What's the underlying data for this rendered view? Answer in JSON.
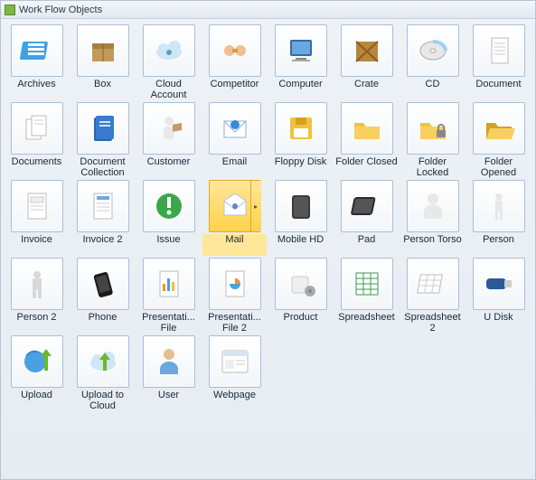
{
  "title": "Work Flow Objects",
  "selected": "mail",
  "items": [
    {
      "id": "archives",
      "label": "Archives"
    },
    {
      "id": "box",
      "label": "Box"
    },
    {
      "id": "cloud-account",
      "label": "Cloud Account"
    },
    {
      "id": "competitor",
      "label": "Competitor"
    },
    {
      "id": "computer",
      "label": "Computer"
    },
    {
      "id": "crate",
      "label": "Crate"
    },
    {
      "id": "cd",
      "label": "CD"
    },
    {
      "id": "document",
      "label": "Document"
    },
    {
      "id": "documents",
      "label": "Documents"
    },
    {
      "id": "document-collection",
      "label": "Document Collection"
    },
    {
      "id": "customer",
      "label": "Customer"
    },
    {
      "id": "email",
      "label": "Email"
    },
    {
      "id": "floppy-disk",
      "label": "Floppy Disk"
    },
    {
      "id": "folder-closed",
      "label": "Folder Closed"
    },
    {
      "id": "folder-locked",
      "label": "Folder Locked"
    },
    {
      "id": "folder-opened",
      "label": "Folder Opened"
    },
    {
      "id": "invoice",
      "label": "Invoice"
    },
    {
      "id": "invoice-2",
      "label": "Invoice 2"
    },
    {
      "id": "issue",
      "label": "Issue"
    },
    {
      "id": "mail",
      "label": "Mail"
    },
    {
      "id": "mobile-hd",
      "label": "Mobile HD"
    },
    {
      "id": "pad",
      "label": "Pad"
    },
    {
      "id": "person-torso",
      "label": "Person Torso"
    },
    {
      "id": "person",
      "label": "Person"
    },
    {
      "id": "person-2",
      "label": "Person 2"
    },
    {
      "id": "phone",
      "label": "Phone"
    },
    {
      "id": "presentation-file",
      "label": "Presentati... File"
    },
    {
      "id": "presentation-file-2",
      "label": "Presentati... File 2"
    },
    {
      "id": "product",
      "label": "Product"
    },
    {
      "id": "spreadsheet",
      "label": "Spreadsheet"
    },
    {
      "id": "spreadsheet-2",
      "label": "Spreadsheet 2"
    },
    {
      "id": "u-disk",
      "label": "U Disk"
    },
    {
      "id": "upload",
      "label": "Upload"
    },
    {
      "id": "upload-to-cloud",
      "label": "Upload to Cloud"
    },
    {
      "id": "user",
      "label": "User"
    },
    {
      "id": "webpage",
      "label": "Webpage"
    }
  ]
}
